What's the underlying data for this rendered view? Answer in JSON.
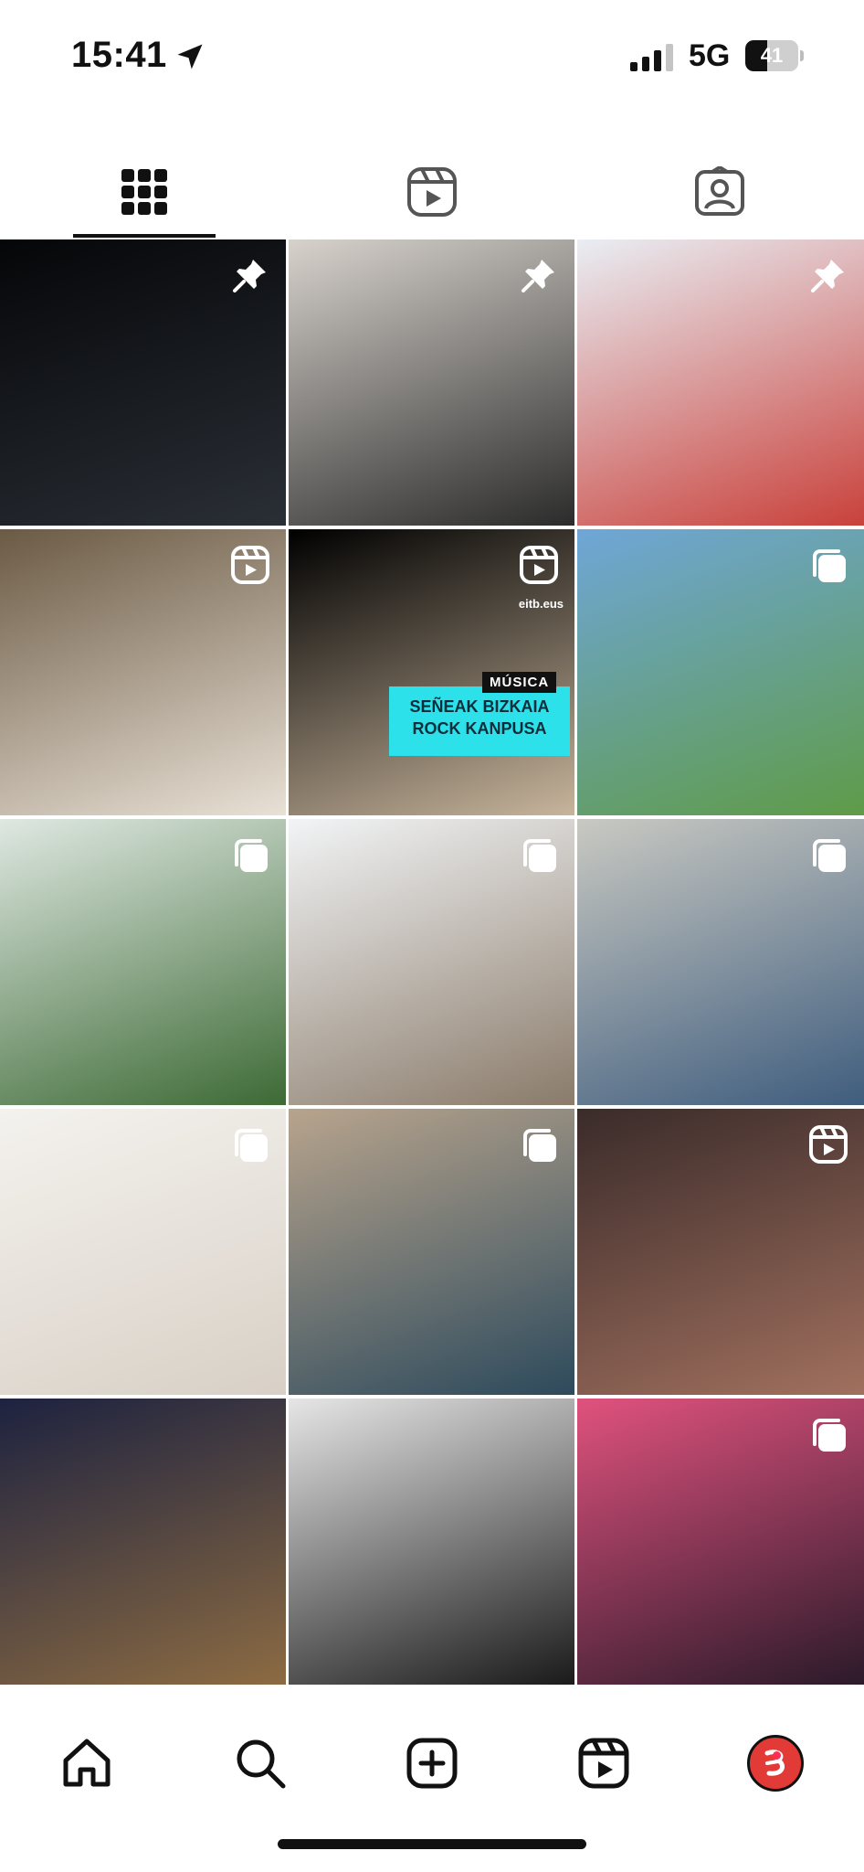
{
  "status_bar": {
    "time": "15:41",
    "network": "5G",
    "battery_level": "41",
    "battery_fraction": 0.41
  },
  "profile_tabs": [
    {
      "id": "grid",
      "icon": "grid-icon",
      "selected": true
    },
    {
      "id": "reels",
      "icon": "reels-icon",
      "selected": false
    },
    {
      "id": "tagged",
      "icon": "tagged-person-icon",
      "selected": false
    }
  ],
  "posts": [
    {
      "type": "pinned",
      "icon": "pin-icon",
      "palette": [
        "#050608",
        "#2a2f36"
      ]
    },
    {
      "type": "pinned",
      "icon": "pin-icon",
      "palette": [
        "#d7d2cc",
        "#2b2b2b"
      ]
    },
    {
      "type": "pinned",
      "icon": "pin-icon",
      "palette": [
        "#e9eef4",
        "#c9413b"
      ]
    },
    {
      "type": "reel",
      "icon": "reel-icon",
      "palette": [
        "#6b5a44",
        "#e9e1d6"
      ]
    },
    {
      "type": "reel",
      "icon": "reel-icon",
      "palette": [
        "#000000",
        "#c7b49b"
      ],
      "overlay": {
        "tag": "MÚSICA",
        "title": "SEÑEAK BIZKAIA ROCK KANPUSA",
        "logo": "eitb.eus"
      }
    },
    {
      "type": "carousel",
      "icon": "carousel-icon",
      "palette": [
        "#6fa6d8",
        "#5f9b48"
      ]
    },
    {
      "type": "carousel",
      "icon": "carousel-icon",
      "palette": [
        "#dfe8e2",
        "#3d6a35"
      ]
    },
    {
      "type": "carousel",
      "icon": "carousel-icon",
      "palette": [
        "#f2f4f6",
        "#8a7b6a"
      ]
    },
    {
      "type": "carousel",
      "icon": "carousel-icon",
      "palette": [
        "#c9c9c2",
        "#3f5d7e"
      ]
    },
    {
      "type": "carousel",
      "icon": "carousel-icon",
      "palette": [
        "#f4f2ee",
        "#d8d0c6"
      ]
    },
    {
      "type": "carousel",
      "icon": "carousel-icon",
      "palette": [
        "#b8a48d",
        "#2d4a5c"
      ]
    },
    {
      "type": "reel",
      "icon": "reel-icon",
      "palette": [
        "#3a2b2a",
        "#a1705e"
      ]
    },
    {
      "type": "photo",
      "icon": "",
      "palette": [
        "#1d2240",
        "#8c6b42"
      ]
    },
    {
      "type": "photo",
      "icon": "",
      "palette": [
        "#e6e6e6",
        "#1a1a1a"
      ]
    },
    {
      "type": "carousel",
      "icon": "carousel-icon",
      "palette": [
        "#e0527e",
        "#2b1a2a"
      ]
    }
  ],
  "bottom_nav": [
    {
      "id": "home",
      "icon": "home-icon"
    },
    {
      "id": "search",
      "icon": "search-icon"
    },
    {
      "id": "create",
      "icon": "create-plus-icon"
    },
    {
      "id": "reels",
      "icon": "reels-icon"
    },
    {
      "id": "profile",
      "icon": "profile-avatar",
      "has_notification": true,
      "accent": "#e23a36"
    }
  ]
}
